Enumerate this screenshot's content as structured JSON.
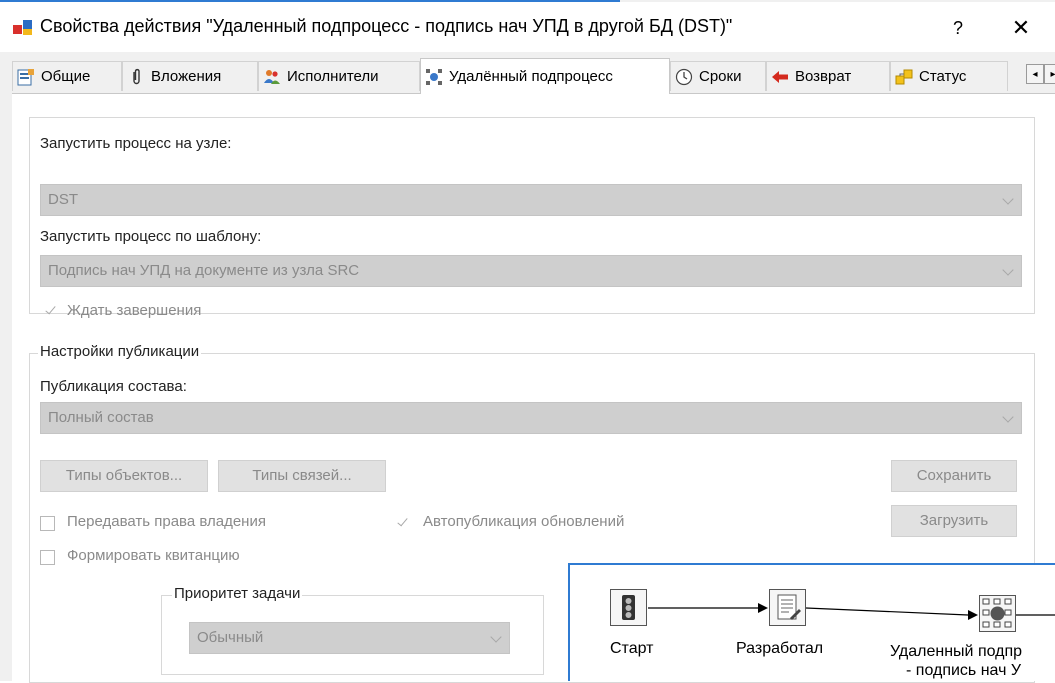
{
  "window": {
    "title": "Свойства действия \"Удаленный подпроцесс - подпись нач УПД в другой БД (DST)\"",
    "help": "?",
    "close": "✕"
  },
  "tabs": [
    {
      "label": "Общие",
      "icon": "general-properties-icon"
    },
    {
      "label": "Вложения",
      "icon": "paperclip-icon"
    },
    {
      "label": "Исполнители",
      "icon": "users-icon"
    },
    {
      "label": "Удалённый подпроцесс",
      "icon": "remote-subprocess-icon",
      "active": true
    },
    {
      "label": "Сроки",
      "icon": "clock-icon"
    },
    {
      "label": "Возврат",
      "icon": "red-arrow-left-icon"
    },
    {
      "label": "Статус",
      "icon": "status-icon"
    }
  ],
  "tab_scroll": {
    "left": "◂",
    "right": "▸"
  },
  "subprocess": {
    "node_label": "Запустить процесс на узле:",
    "node_value": "DST",
    "template_label": "Запустить процесс по шаблону:",
    "template_value": "Подпись  нач УПД на документе из узла SRC",
    "wait_label": "Ждать завершения",
    "wait_checked": true
  },
  "publication": {
    "group_title": "Настройки публикации",
    "composition_label": "Публикация состава:",
    "composition_value": "Полный состав",
    "object_types_btn": "Типы объектов...",
    "link_types_btn": "Типы связей...",
    "save_btn": "Сохранить",
    "load_btn": "Загрузить",
    "transfer_ownership": {
      "label": "Передавать права владения",
      "checked": false
    },
    "auto_publish": {
      "label": "Автопубликация обновлений",
      "checked": true
    },
    "receipt": {
      "label": "Формировать квитанцию",
      "checked": false
    },
    "priority_title": "Приоритет задачи",
    "priority_value": "Обычный"
  },
  "workflow": {
    "nodes": [
      {
        "label": "Старт",
        "icon": "traffic-light-icon"
      },
      {
        "label": "Разработал",
        "icon": "document-edit-icon"
      },
      {
        "label": "Удаленный подпр",
        "label2": "- подпись нач У",
        "icon": "remote-subprocess-node-icon"
      }
    ]
  },
  "colors": {
    "accent": "#2f7bd2",
    "disabled_field": "#cfcfcf",
    "disabled_text": "#8a8a8a"
  }
}
